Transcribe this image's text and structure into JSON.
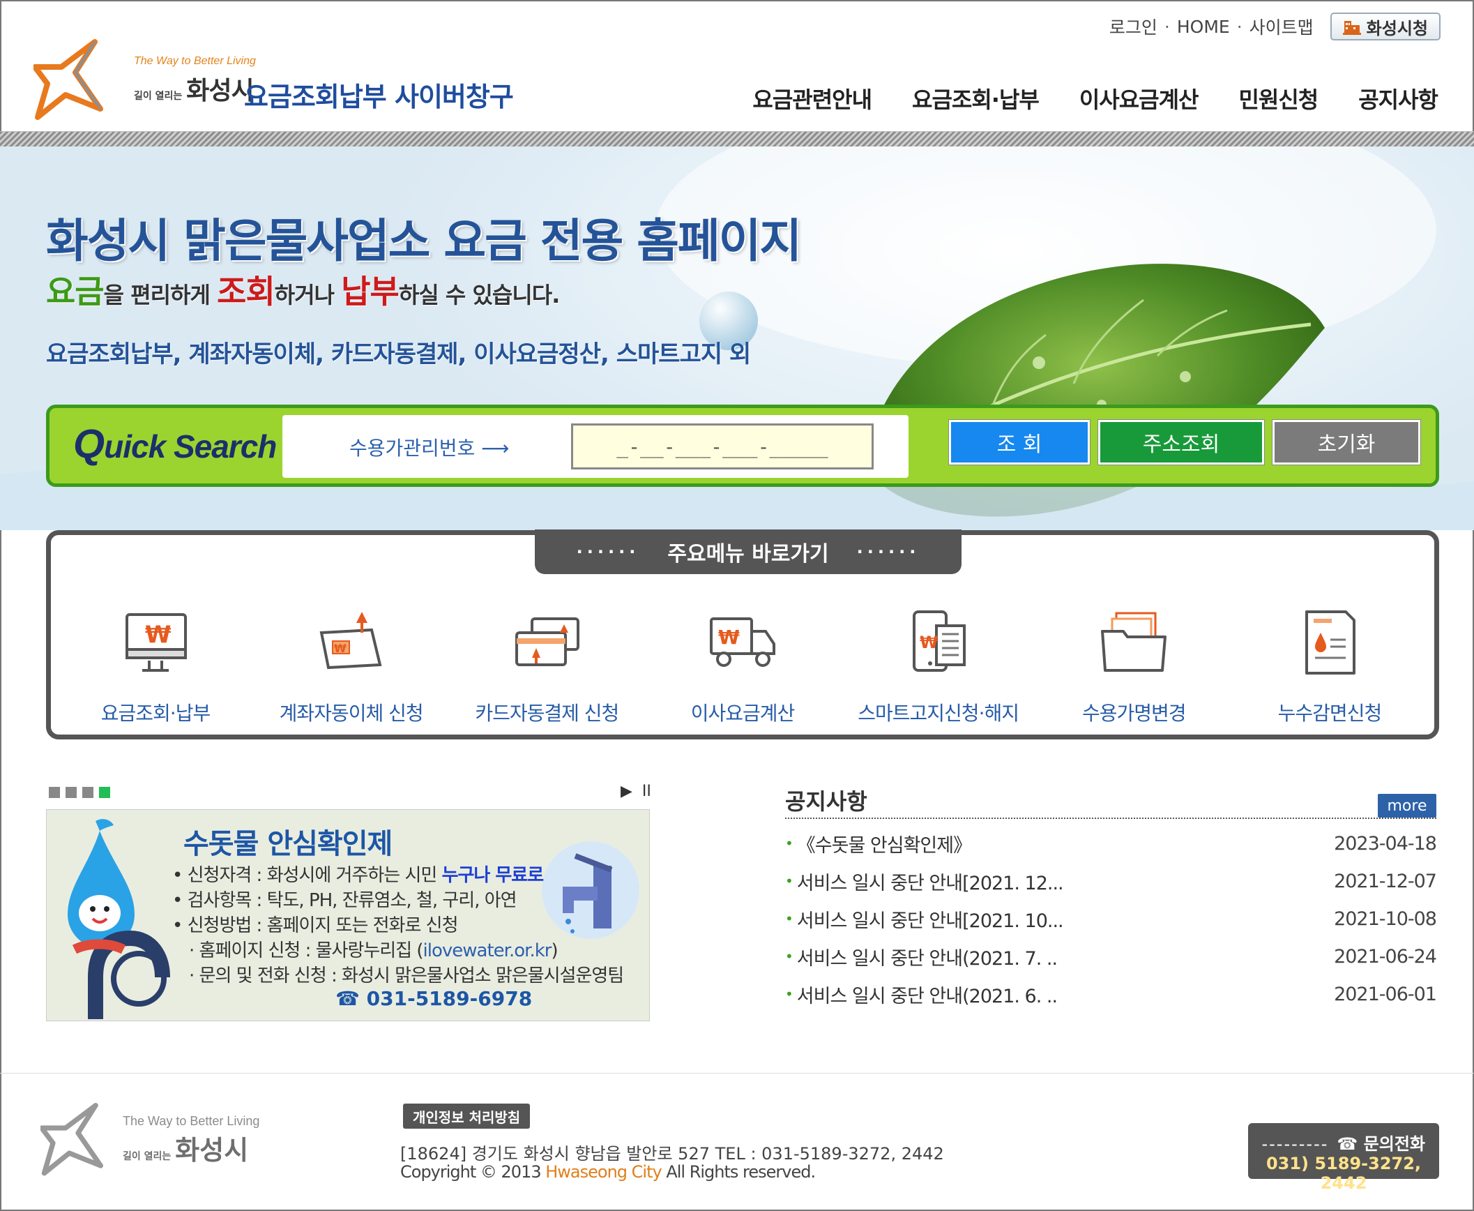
{
  "util": {
    "login": "로그인",
    "home": "HOME",
    "sitemap": "사이트맵",
    "city_button": "화성시청"
  },
  "logo": {
    "slogan": "The Way to Better Living",
    "small": "길이 열리는",
    "city": "화성시"
  },
  "site_title": "요금조회납부 사이버창구",
  "gnb": [
    "요금관련안내",
    "요금조회·납부",
    "이사요금계산",
    "민원신청",
    "공지사항"
  ],
  "hero": {
    "title": "화성시 맑은물사업소 요금 전용 홈페이지",
    "sub_a": "요금",
    "sub_b": "을 편리하게 ",
    "sub_c": "조회",
    "sub_d": "하거나 ",
    "sub_e": "납부",
    "sub_f": "하실 수 있습니다.",
    "services": "요금조회납부, 계좌자동이체, 카드자동결제, 이사요금정산, 스마트고지 외"
  },
  "quick_search": {
    "label_q": "Q",
    "label_rest": "uick Search",
    "field_label": "수용가관리번호",
    "arrow": "⟶",
    "input_value": "_-__-___-___-_____",
    "search_button": "조  회",
    "address_button": "주소조회",
    "reset_button": "초기화"
  },
  "main_menu": {
    "caption": "주요메뉴 바로가기",
    "dots": "······",
    "items": [
      {
        "label": "요금조회·납부",
        "icon": "monitor-won-icon"
      },
      {
        "label": "계좌자동이체 신청",
        "icon": "bankbook-icon"
      },
      {
        "label": "카드자동결제 신청",
        "icon": "card-icon"
      },
      {
        "label": "이사요금계산",
        "icon": "truck-icon"
      },
      {
        "label": "스마트고지신청·해지",
        "icon": "smartphone-bill-icon"
      },
      {
        "label": "수용가명변경",
        "icon": "folder-icon"
      },
      {
        "label": "누수감면신청",
        "icon": "water-doc-icon"
      }
    ]
  },
  "banner": {
    "play": "▶",
    "pause": "II",
    "title": "수돗물 안심확인제",
    "line1_a": "신청자격 : 화성시에 거주하는 시민 ",
    "line1_b": "누구나 무료로",
    "line2": "검사항목 : 탁도, PH, 잔류염소, 철, 구리, 아연",
    "line3": "신청방법 : 홈페이지 또는 전화로 신청",
    "line4_a": "홈페이지 신청 : 물사랑누리집 (",
    "line4_b": "ilovewater.or.kr",
    "line4_c": ")",
    "line5": "문의 및 전화 신청 : 화성시 맑은물사업소 맑은물시설운영팀",
    "tel": "☎ 031-5189-6978"
  },
  "notice": {
    "title": "공지사항",
    "more": "more",
    "items": [
      {
        "title": "《수돗물 안심확인제》",
        "date": "2023-04-18"
      },
      {
        "title": "서비스 일시 중단 안내[2021. 12...",
        "date": "2021-12-07"
      },
      {
        "title": "서비스 일시 중단 안내[2021. 10...",
        "date": "2021-10-08"
      },
      {
        "title": "서비스 일시 중단 안내(2021. 7. ..",
        "date": "2021-06-24"
      },
      {
        "title": "서비스 일시 중단 안내(2021. 6. ..",
        "date": "2021-06-01"
      }
    ]
  },
  "footer": {
    "privacy": "개인정보 처리방침",
    "address": "[18624] 경기도 화성시 향남읍 발안로 527   TEL : 031-5189-3272, 2442",
    "copy_a": "Copyright © 2013 ",
    "copy_b": "Hwaseong City",
    "copy_c": " All Rights reserved.",
    "tel_label": "문의전화",
    "tel_dash": "---------",
    "tel_number": "031) 5189-3272, 2442"
  },
  "colors": {
    "brand_blue": "#245398",
    "quick_green": "#9bd42f",
    "search_blue": "#1688f0",
    "address_green": "#189a3a",
    "reset_gray": "#7b7b7b"
  }
}
